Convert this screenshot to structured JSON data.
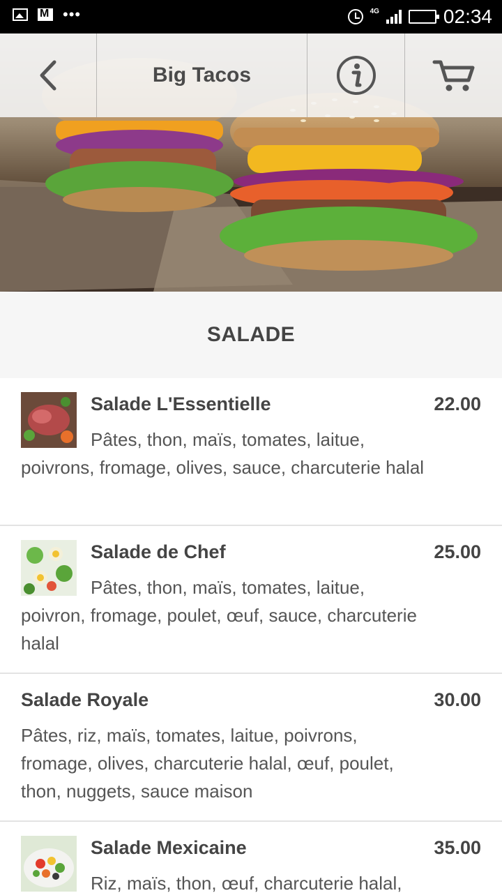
{
  "status_bar": {
    "time": "02:34",
    "network": "4G",
    "icons": [
      "image-icon",
      "gmail-icon",
      "more-dots-icon",
      "alarm-icon",
      "signal-icon",
      "battery-icon"
    ]
  },
  "toolbar": {
    "title": "Big Tacos",
    "icons": [
      "back-chevron-icon",
      "info-icon",
      "cart-icon"
    ]
  },
  "section": {
    "title": "SALADE"
  },
  "items": [
    {
      "name": "Salade L'Essentielle",
      "price": "22.00",
      "description": "Pâtes, thon, maïs, tomates, laitue, poivrons, fromage, olives, sauce, charcuterie halal",
      "has_thumb": true
    },
    {
      "name": "Salade de Chef",
      "price": "25.00",
      "description": "Pâtes, thon, maïs, tomates, laitue, poivron, fromage, poulet, œuf, sauce, charcuterie halal",
      "has_thumb": true
    },
    {
      "name": "Salade Royale",
      "price": "30.00",
      "description": "Pâtes, riz, maïs, tomates, laitue, poivrons, fromage, olives, charcuterie halal, œuf, poulet, thon, nuggets, sauce maison",
      "has_thumb": false
    },
    {
      "name": "Salade Mexicaine",
      "price": "35.00",
      "description": "Riz, maïs, thon, œuf, charcuterie halal,",
      "has_thumb": true
    }
  ]
}
